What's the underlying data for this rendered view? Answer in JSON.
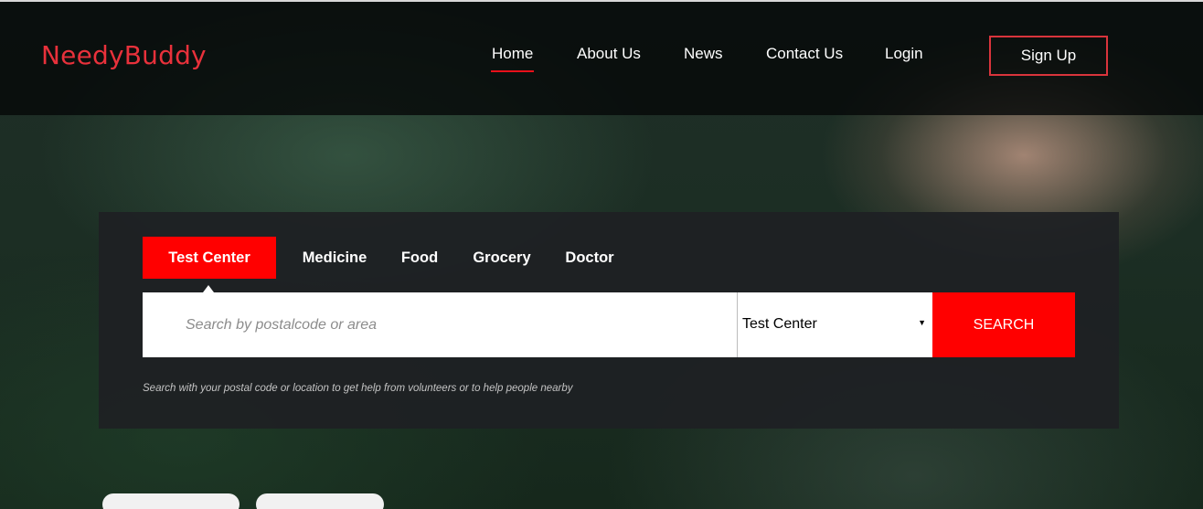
{
  "brand": "NeedyBuddy",
  "nav": {
    "items": [
      {
        "label": "Home",
        "active": true
      },
      {
        "label": "About Us"
      },
      {
        "label": "News"
      },
      {
        "label": "Contact Us"
      },
      {
        "label": "Login"
      }
    ],
    "signup_label": "Sign Up"
  },
  "search": {
    "tabs": [
      {
        "label": "Test Center",
        "active": true
      },
      {
        "label": "Medicine"
      },
      {
        "label": "Food"
      },
      {
        "label": "Grocery"
      },
      {
        "label": "Doctor"
      }
    ],
    "placeholder": "Search by postalcode or area",
    "category_selected": "Test Center",
    "button_label": "SEARCH",
    "hint": "Search with your postal code or location to get help from volunteers or to help people nearby"
  },
  "colors": {
    "accent": "#ff0000",
    "brand": "#e8313b",
    "nav_bg": "#070909",
    "panel_bg": "#1e2023"
  },
  "icons": {
    "select_arrow": "chevron-down-icon"
  }
}
